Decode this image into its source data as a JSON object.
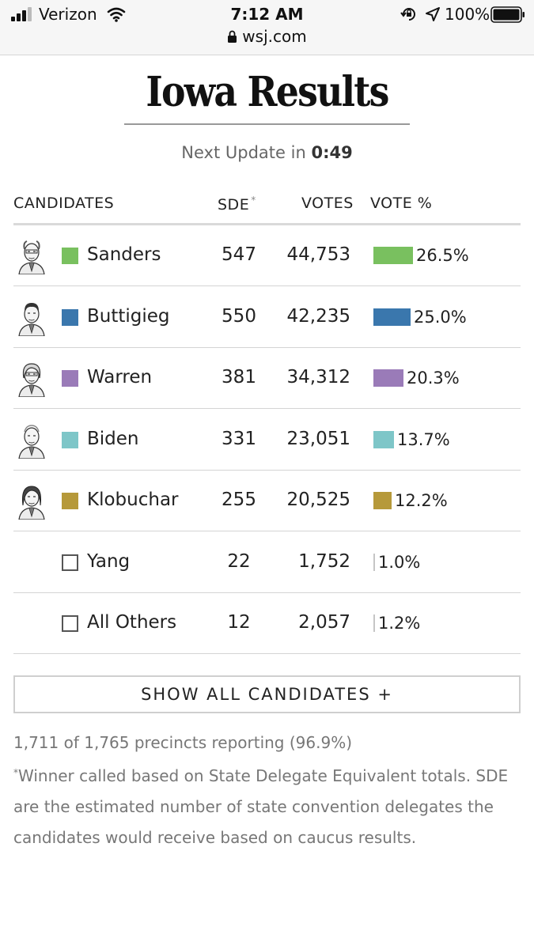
{
  "status": {
    "carrier": "Verizon",
    "time": "7:12 AM",
    "battery_pct": "100%",
    "url": "wsj.com"
  },
  "header": {
    "title": "Iowa Results",
    "update_prefix": "Next Update in ",
    "update_time": "0:49"
  },
  "table": {
    "col_candidates": "CANDIDATES",
    "col_sde": "SDE",
    "col_sde_mark": "*",
    "col_votes": "VOTES",
    "col_vote_pct": "VOTE %",
    "rows": [
      {
        "name": "Sanders",
        "sde": "547",
        "votes": "44,753",
        "pct_label": "26.5%",
        "pct": 26.5,
        "color": "#79c05f",
        "photo": "sanders-portrait-icon"
      },
      {
        "name": "Buttigieg",
        "sde": "550",
        "votes": "42,235",
        "pct_label": "25.0%",
        "pct": 25.0,
        "color": "#3a77ad",
        "photo": "buttigieg-portrait-icon"
      },
      {
        "name": "Warren",
        "sde": "381",
        "votes": "34,312",
        "pct_label": "20.3%",
        "pct": 20.3,
        "color": "#9a7bb8",
        "photo": "warren-portrait-icon"
      },
      {
        "name": "Biden",
        "sde": "331",
        "votes": "23,051",
        "pct_label": "13.7%",
        "pct": 13.7,
        "color": "#7ec6c8",
        "photo": "biden-portrait-icon"
      },
      {
        "name": "Klobuchar",
        "sde": "255",
        "votes": "20,525",
        "pct_label": "12.2%",
        "pct": 12.2,
        "color": "#b6993a",
        "photo": "klobuchar-portrait-icon"
      },
      {
        "name": "Yang",
        "sde": "22",
        "votes": "1,752",
        "pct_label": "1.0%",
        "pct": 1.0,
        "color": "#cccccc",
        "photo": ""
      },
      {
        "name": "All Others",
        "sde": "12",
        "votes": "2,057",
        "pct_label": "1.2%",
        "pct": 1.2,
        "color": "#cccccc",
        "photo": ""
      }
    ]
  },
  "show_all_label": "SHOW ALL CANDIDATES +",
  "footer": {
    "precincts": "1,711 of 1,765 precincts reporting (96.9%)",
    "note_mark": "*",
    "note": "Winner called based on State Delegate Equivalent totals. SDE are the estimated number of state convention delegates the candidates would receive based on caucus results."
  }
}
